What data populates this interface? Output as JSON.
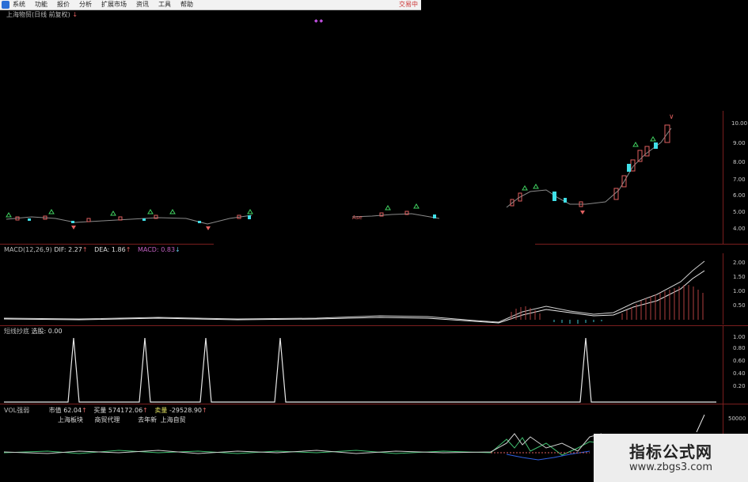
{
  "menu": {
    "items": [
      "系统",
      "功能",
      "报价",
      "分析",
      "扩展市场",
      "资讯",
      "工具",
      "帮助"
    ],
    "brand": "交易中"
  },
  "main_panel": {
    "title": "上海物贸(日线 前复权)",
    "marker": "↓",
    "purple_marker": "◆ ◆",
    "scale": [
      "10.00",
      "9.00",
      "8.00",
      "7.00",
      "6.00",
      "5.00",
      "4.00"
    ],
    "scale_marker": "∨",
    "annotation": "Ase"
  },
  "macd_panel": {
    "name": "MACD(12,26,9)",
    "dif_label": "DIF:",
    "dif_value": "2.27",
    "dif_arrow": "↑",
    "dea_label": "DEA:",
    "dea_value": "1.86",
    "dea_arrow": "↑",
    "macd_label": "MACD:",
    "macd_value": "0.83",
    "macd_arrow": "↓",
    "scale": [
      "2.00",
      "1.50",
      "1.00",
      "0.50"
    ]
  },
  "signal_panel": {
    "name": "短线抄底",
    "select_label": "选股:",
    "select_value": "0.00",
    "scale": [
      "1.00",
      "0.80",
      "0.60",
      "0.40",
      "0.20"
    ]
  },
  "vol_panel": {
    "name": "VOL强弱",
    "market_label": "市值",
    "market_value": "62.04",
    "market_arrow": "↑",
    "buy_label": "买量",
    "buy_value": "574172.06",
    "buy_arrow": "↑",
    "sell_label": "卖量",
    "sell_value": "-29528.90",
    "sell_arrow": "↑",
    "tags": [
      "上海板块",
      "商贸代理",
      "去年新",
      "上海自贸"
    ],
    "scale": [
      "50000"
    ]
  },
  "watermark": {
    "title": "指标公式网",
    "url": "www.zbgs3.com"
  },
  "colors": {
    "up": "#e06060",
    "down": "#40e0e8",
    "line": "#e8e8e8",
    "frame": "#7a1e1e",
    "dea": "#d0d0d0",
    "vol_green": "#40c070",
    "vol_blue": "#3060e0"
  }
}
